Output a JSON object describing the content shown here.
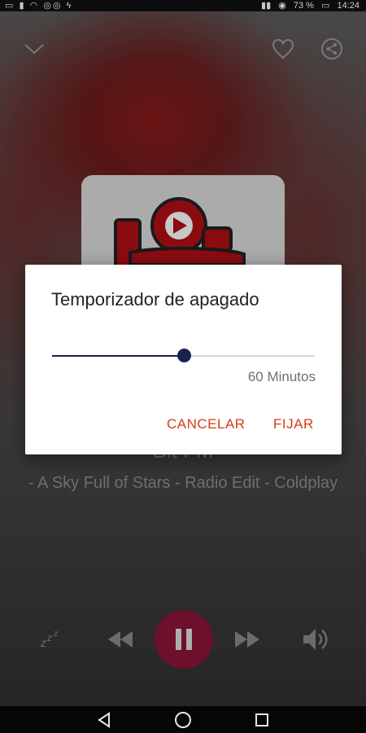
{
  "status_bar": {
    "left_icons": [
      "sim-icon",
      "signal-icon",
      "wifi-icon",
      "notification-icons"
    ],
    "battery_percent": "73 %",
    "time": "14:24"
  },
  "player": {
    "station_name": "Bit FM",
    "song_title": "- A Sky Full of Stars - Radio Edit - Coldplay",
    "state": "playing",
    "colors": {
      "play_button": "#8e1538",
      "controls": "#8a8a8a"
    }
  },
  "dialog": {
    "title": "Temporizador de apagado",
    "slider_value_label": "60 Minutos",
    "slider_fraction": 0.5,
    "cancel_label": "CANCELAR",
    "confirm_label": "FIJAR",
    "colors": {
      "accent": "#d83b14",
      "slider": "#1a2350"
    }
  },
  "icons": {
    "top_left": "chevron-down-icon",
    "top_right": [
      "heart-icon",
      "share-icon"
    ],
    "controls": [
      "sleep-icon",
      "rewind-icon",
      "pause-icon",
      "fast-forward-icon",
      "volume-icon"
    ],
    "nav": [
      "back-icon",
      "home-icon",
      "recents-icon"
    ]
  }
}
